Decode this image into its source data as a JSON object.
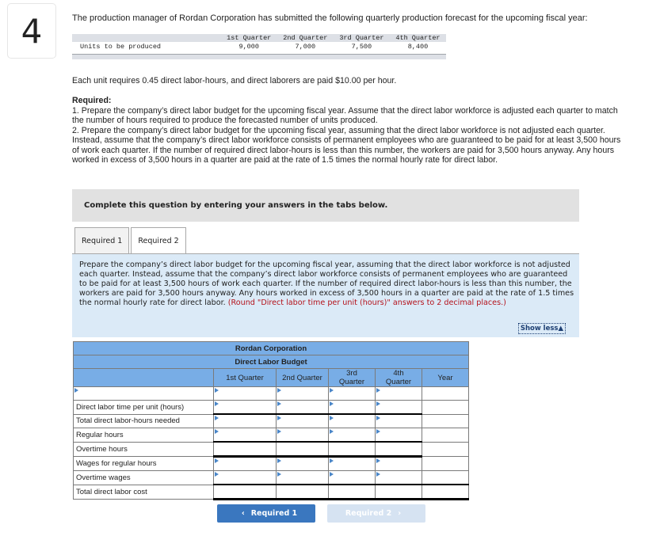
{
  "question_number": "4",
  "intro": "The production manager of Rordan Corporation has submitted the following quarterly production forecast for the upcoming fiscal year:",
  "forecast": {
    "headers": [
      "1st Quarter",
      "2nd Quarter",
      "3rd Quarter",
      "4th Quarter"
    ],
    "row_label": "Units to be produced",
    "values": [
      "9,000",
      "7,000",
      "7,500",
      "8,400"
    ]
  },
  "labor_info": "Each unit requires 0.45 direct labor-hours, and direct laborers are paid $10.00 per hour.",
  "required_title": "Required:",
  "required_1": "1. Prepare the company’s direct labor budget for the upcoming fiscal year. Assume that the direct labor workforce is adjusted each quarter to match the number of hours required to produce the forecasted number of units produced.",
  "required_2": "2. Prepare the company’s direct labor budget for the upcoming fiscal year, assuming that the direct labor workforce is not adjusted each quarter. Instead, assume that the company’s direct labor workforce consists of permanent employees who are guaranteed to be paid for at least 3,500 hours of work each quarter. If the number of required direct labor-hours is less than this number, the workers are paid for 3,500 hours anyway. Any hours worked in excess of 3,500 hours in a quarter are paid at the rate of 1.5 times the normal hourly rate for direct labor.",
  "complete_prompt": "Complete this question by entering your answers in the tabs below.",
  "tabs": [
    {
      "label": "Required 1",
      "active": false
    },
    {
      "label": "Required 2",
      "active": true
    }
  ],
  "tab_prompt": {
    "text": "Prepare the company’s direct labor budget for the upcoming fiscal year, assuming that the direct labor workforce is not adjusted each quarter. Instead, assume that the company’s direct labor workforce consists of permanent employees who are guaranteed to be paid for at least 3,500 hours of work each quarter. If the number of required direct labor-hours is less than this number, the workers are paid for 3,500 hours anyway. Any hours worked in excess of 3,500 hours in a quarter are paid at the rate of 1.5 times the normal hourly rate for direct labor.",
    "instruction": "(Round \"Direct labor time per unit (hours)\" answers to 2 decimal places.)",
    "show_less": "Show less"
  },
  "budget": {
    "company": "Rordan Corporation",
    "title": "Direct Labor Budget",
    "columns": [
      "1st Quarter",
      "2nd Quarter",
      "3rd Quarter",
      "4th Quarter",
      "Year"
    ],
    "col3_lines": [
      "3rd",
      "Quarter"
    ],
    "col4_lines": [
      "4th",
      "Quarter"
    ],
    "rows": [
      {
        "label": ""
      },
      {
        "label": "Direct labor time per unit (hours)"
      },
      {
        "label": "Total direct labor-hours needed"
      },
      {
        "label": "Regular hours"
      },
      {
        "label": "Overtime hours"
      },
      {
        "label": "Wages for regular hours"
      },
      {
        "label": "Overtime wages"
      },
      {
        "label": "Total direct labor cost"
      }
    ]
  },
  "nav": {
    "prev_label": "Required 1",
    "next_label": "Required 2"
  }
}
